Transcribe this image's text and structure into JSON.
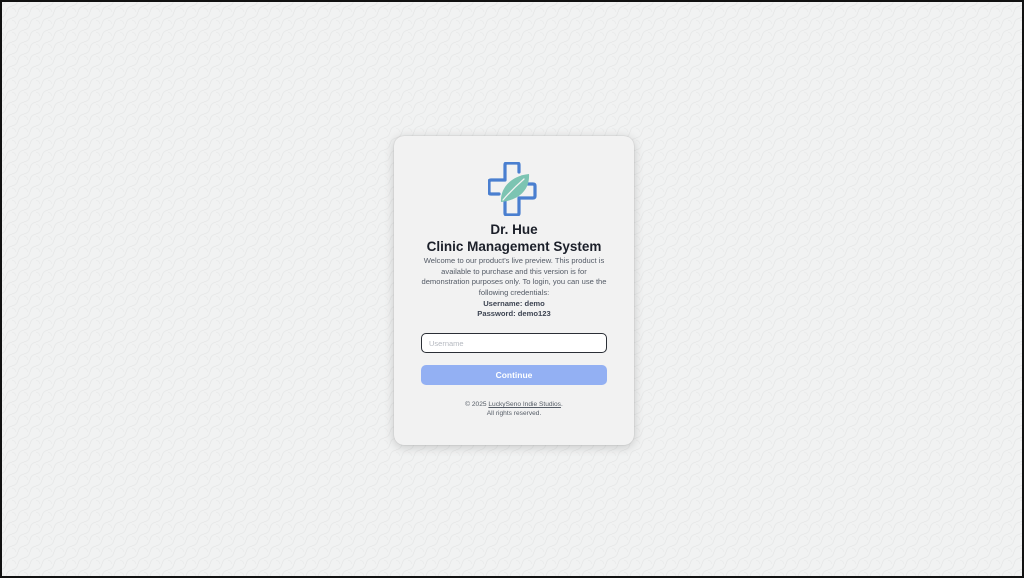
{
  "app": {
    "title_line1": "Dr. Hue",
    "title_line2": "Clinic Management System",
    "logo_icon": "medical-cross-leaf-icon"
  },
  "intro": {
    "text": "Welcome to our product's live preview. This product is available to purchase and this version is for demonstration purposes only. To login, you can use the following credentials:",
    "username_line": "Username: demo",
    "password_line": "Password: demo123"
  },
  "form": {
    "username_placeholder": "Username",
    "username_value": "",
    "continue_label": "Continue"
  },
  "footer": {
    "copyright_prefix": "© 2025",
    "studio_link": "LuckySeno Indie Studios",
    "period": ".",
    "rights": "All rights reserved."
  },
  "colors": {
    "accent_blue": "#4a7fd0",
    "leaf_green": "#7cc4b2",
    "button": "#93b0f3",
    "card_bg": "#f2f2f2"
  }
}
